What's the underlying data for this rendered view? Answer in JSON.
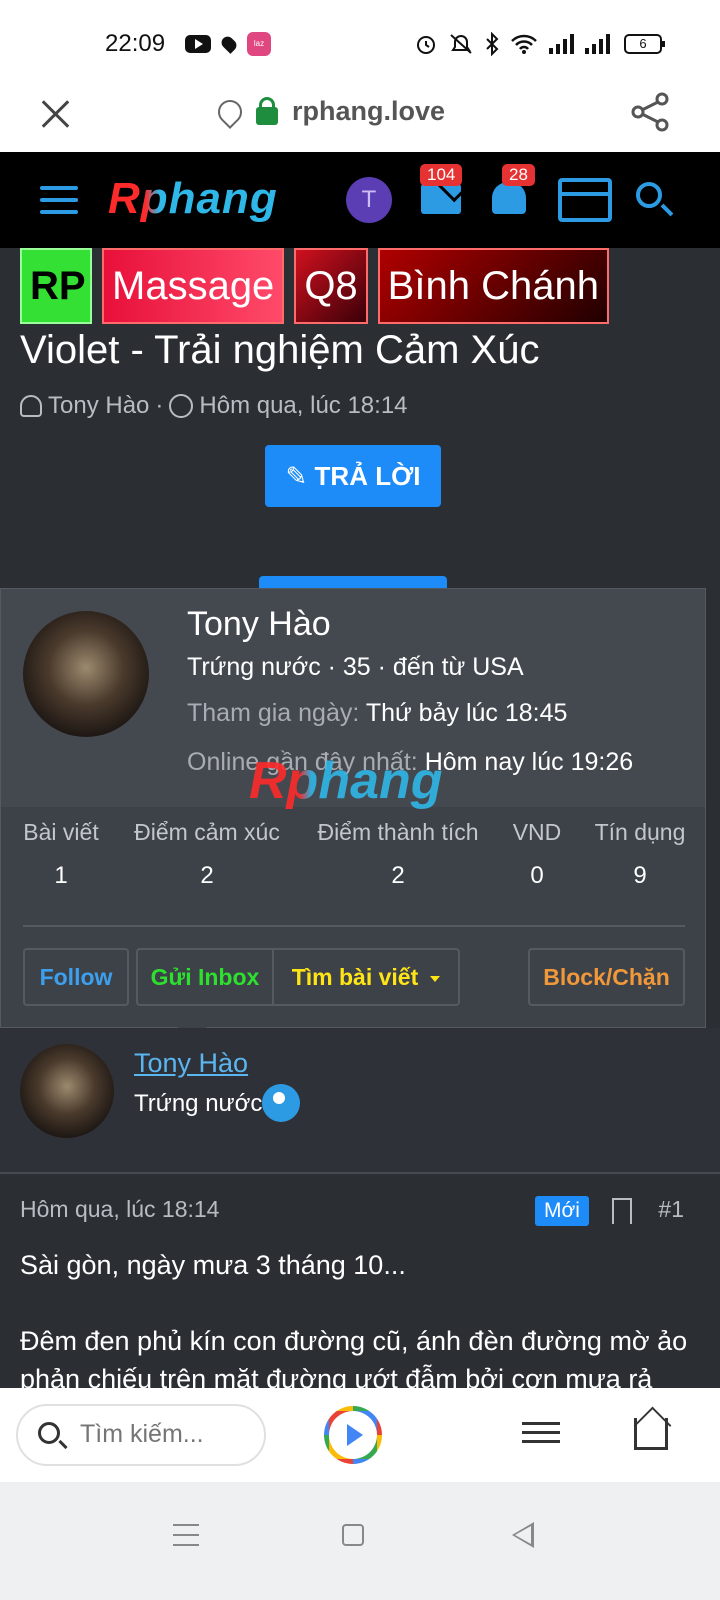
{
  "status_bar": {
    "time": "22:09",
    "battery": "6"
  },
  "url_bar": {
    "domain": "rphang.love"
  },
  "site_header": {
    "logo": "Rphang",
    "avatar_letter": "T",
    "inbox_count": "104",
    "alerts_count": "28"
  },
  "thread": {
    "prefixes": [
      "RP",
      "Massage",
      "Q8",
      "Bình Chánh"
    ],
    "title": "Violet - Trải nghiệm Cảm Xúc",
    "author": "Tony Hào",
    "separator": "·",
    "date": "Hôm qua, lúc 18:14",
    "reply_label": "TRẢ LỜI"
  },
  "member_card": {
    "name": "Tony Hào",
    "subtitle": "Trứng nước · 35 · đến từ USA",
    "joined_label": "Tham gia ngày:",
    "joined_value": "Thứ bảy lúc 18:45",
    "online_label": "Online gần đây nhất:",
    "online_value": "Hôm nay lúc 19:26",
    "watermark": "Rphang",
    "stats": [
      {
        "label": "Bài viết",
        "value": "1"
      },
      {
        "label": "Điểm cảm xúc",
        "value": "2"
      },
      {
        "label": "Điểm thành tích",
        "value": "2"
      },
      {
        "label": "VND",
        "value": "0"
      },
      {
        "label": "Tín dụng",
        "value": "9"
      }
    ],
    "buttons": {
      "follow": "Follow",
      "inbox": "Gửi Inbox",
      "find_posts": "Tìm bài viết",
      "block": "Block/Chặn"
    },
    "colors": {
      "follow": "#3da0ee",
      "inbox": "#2ee02e",
      "find_posts": "#ffe516",
      "block": "#f0983a"
    }
  },
  "post": {
    "author_name": "Tony Hào",
    "author_title": "Trứng nước",
    "date": "Hôm qua, lúc 18:14",
    "new_label": "Mới",
    "post_number": "#1",
    "paragraph_1": "Sài gòn, ngày mưa 3 tháng 10...",
    "paragraph_2": "Đêm đen phủ kín con đường cũ, ánh đèn đường mờ ảo phản chiếu trên mặt đường ướt đẫm bởi cơn mưa rả"
  },
  "bottom_bar": {
    "search_placeholder": "Tìm kiếm..."
  }
}
